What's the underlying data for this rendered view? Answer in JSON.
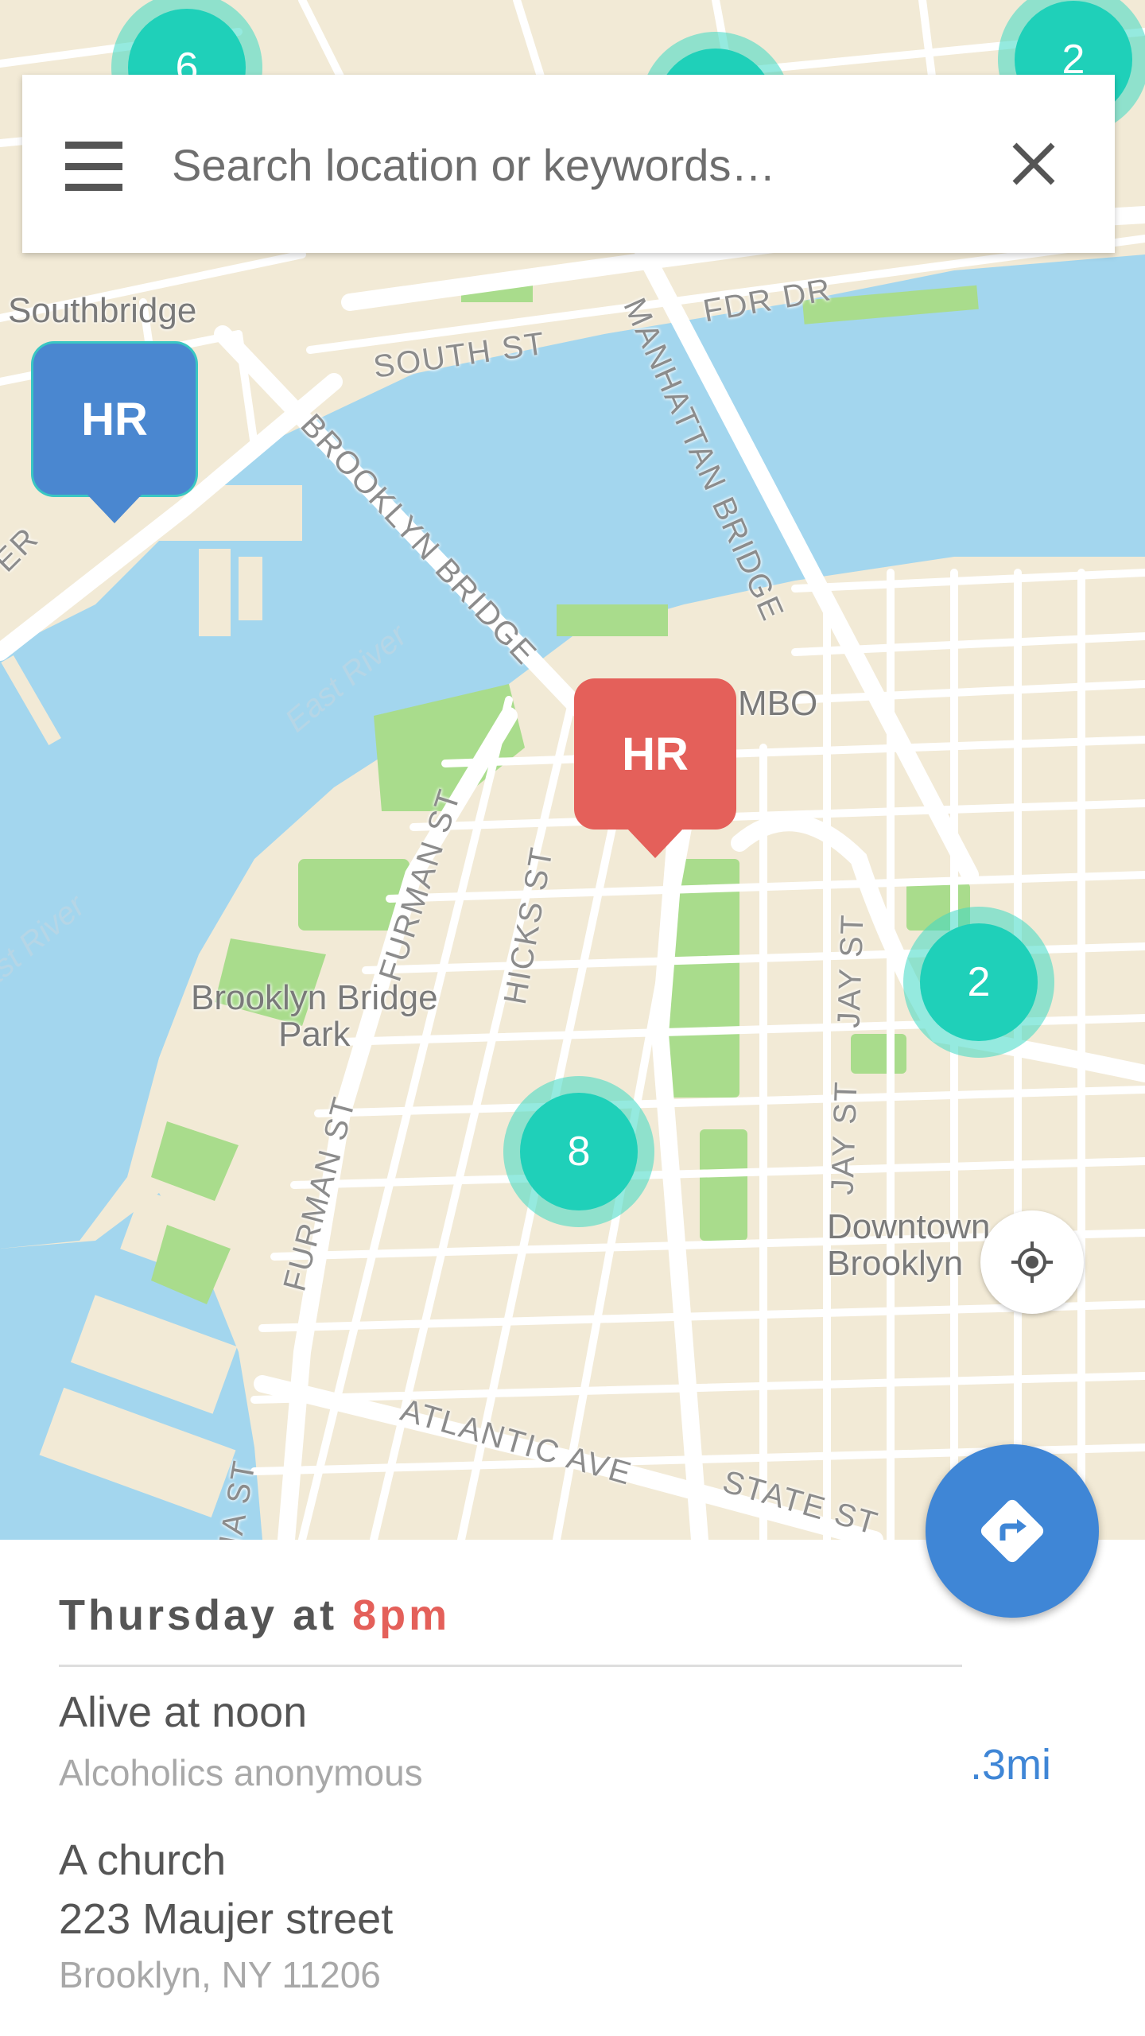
{
  "search": {
    "placeholder": "Search location or keywords…"
  },
  "map": {
    "labels": {
      "southbridge": "Southbridge",
      "south_st": "SOUTH ST",
      "fdr_dr": "FDR DR",
      "brooklyn_bridge": "BROOKLYN BRIDGE",
      "manhattan_bridge": "MANHATTAN BRIDGE",
      "east_river_1": "East River",
      "east_river_2": "East River",
      "dumbo": "MBO",
      "furman_st_1": "FURMAN ST",
      "furman_st_2": "FURMAN ST",
      "hicks_st": "HICKS ST",
      "jay_st_1": "JAY ST",
      "jay_st_2": "JAY ST",
      "brooklyn_bridge_park": "Brooklyn Bridge\nPark",
      "downtown_brooklyn": "Downtown\nBrooklyn",
      "atlantic_ave": "ATLANTIC AVE",
      "state_st": "STATE ST",
      "ia_st": "IA ST",
      "er_fragment": "ER"
    },
    "clusters": [
      {
        "id": "top-left",
        "count": "6"
      },
      {
        "id": "top-center",
        "count": ""
      },
      {
        "id": "top-right",
        "count": "2"
      },
      {
        "id": "right",
        "count": "2"
      },
      {
        "id": "center",
        "count": "8"
      }
    ],
    "markers": {
      "blue": "HR",
      "red": "HR"
    },
    "colors": {
      "water": "#a3d6ee",
      "land": "#f2ead6",
      "park": "#a9dc8c",
      "cluster": "#1fd0b9",
      "marker_blue": "#4a87d0",
      "marker_red": "#e4605a",
      "accent_blue": "#3f86d6"
    }
  },
  "meeting": {
    "day": "Thursday",
    "at": "at",
    "time": "8pm",
    "name": "Alive at noon",
    "type": "Alcoholics anonymous",
    "distance": ".3mi",
    "venue": "A church",
    "street": "223 Maujer street",
    "city": "Brooklyn, NY 11206"
  },
  "icons": {
    "menu": "menu-icon",
    "close": "close-icon",
    "locate": "my-location-icon",
    "directions": "directions-icon"
  }
}
